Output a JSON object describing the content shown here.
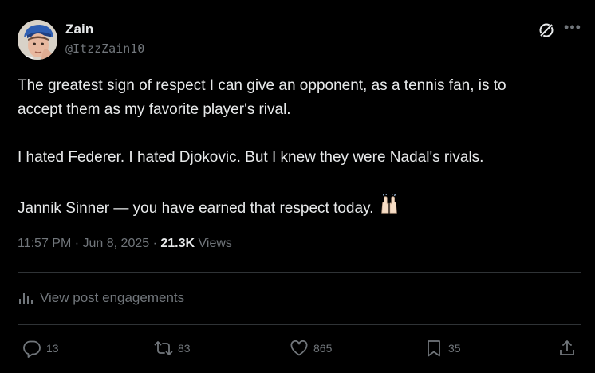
{
  "author": {
    "name": "Zain",
    "handle": "@ItzzZain10"
  },
  "post": {
    "line1": "The greatest sign of respect I can give an opponent, as a tennis fan, is to",
    "line2": "accept them as my favorite player's rival.",
    "line3": "I hated Federer. I hated Djokovic. But I knew they were Nadal's rivals.",
    "line4": "Jannik Sinner — you have earned that respect today.",
    "emoji": "raising-hands-emoji"
  },
  "meta": {
    "time": "11:57 PM",
    "separator1": " · ",
    "date": "Jun 8, 2025",
    "separator2": " · ",
    "views_count": "21.3K",
    "views_label": "Views"
  },
  "engagements_link": "View post engagements",
  "actions": {
    "replies": "13",
    "reposts": "83",
    "likes": "865",
    "bookmarks": "35"
  },
  "icons": [
    "grok-icon",
    "more-icon",
    "bar-chart-icon",
    "reply-icon",
    "repost-icon",
    "like-icon",
    "bookmark-icon",
    "share-icon"
  ],
  "colors": {
    "background": "#000000",
    "text": "#e7e9ea",
    "secondary": "#71767b",
    "divider": "#2f3336"
  }
}
